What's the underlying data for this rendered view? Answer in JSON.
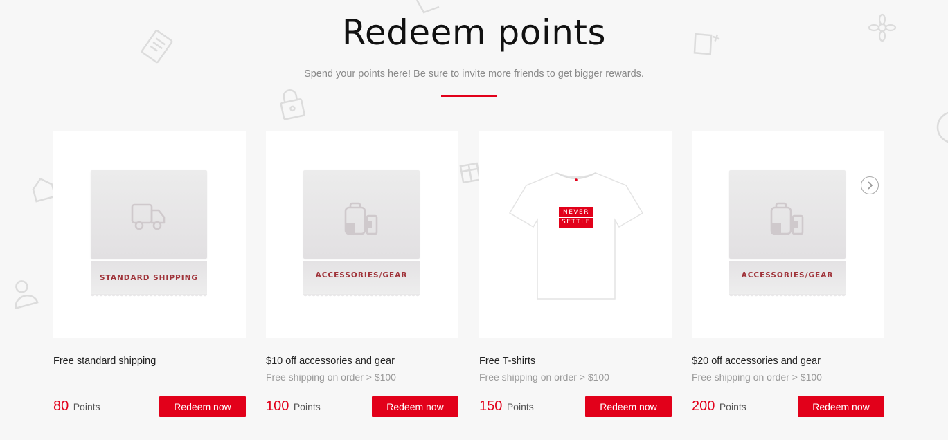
{
  "header": {
    "title": "Redeem points",
    "subtitle": "Spend your points here! Be sure to invite more friends to get bigger rewards."
  },
  "cards": [
    {
      "ticket_label": "STANDARD SHIPPING",
      "image": "truck-icon",
      "name": "Free standard shipping",
      "note": "",
      "points": "80",
      "points_label": "Points",
      "button": "Redeem now"
    },
    {
      "ticket_label": "ACCESSORIES/GEAR",
      "image": "backpack-phone-icon",
      "name": "$10 off accessories and gear",
      "note": "Free shipping on order > $100",
      "points": "100",
      "points_label": "Points",
      "button": "Redeem now"
    },
    {
      "ticket_label": "",
      "image": "tshirt-image",
      "tshirt_text": [
        "NEVER",
        "SETTLE"
      ],
      "name": "Free T-shirts",
      "note": "Free shipping on order > $100",
      "points": "150",
      "points_label": "Points",
      "button": "Redeem now"
    },
    {
      "ticket_label": "ACCESSORIES/GEAR",
      "image": "backpack-phone-icon",
      "name": "$20 off accessories and gear",
      "note": "Free shipping on order > $100",
      "points": "200",
      "points_label": "Points",
      "button": "Redeem now"
    }
  ],
  "carousel": {
    "next_icon": "chevron-right-icon"
  },
  "colors": {
    "accent": "#e2001a",
    "background": "#f7f7f7",
    "ticket_text": "#a0333a"
  }
}
